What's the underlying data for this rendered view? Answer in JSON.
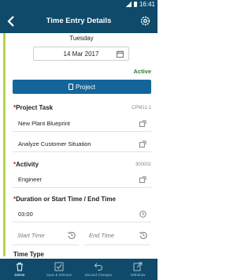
{
  "status_bar": {
    "time": "16:41"
  },
  "header": {
    "title": "Time Entry Details",
    "back_icon": "back-chevron-icon",
    "settings_icon": "gear-icon"
  },
  "entry": {
    "day": "Tuesday",
    "date": "14 Mar 2017",
    "status": "Active"
  },
  "project_button": {
    "label": "Project",
    "icon": "clipboard-icon"
  },
  "project_task": {
    "label": "Project Task",
    "code": "CPM11-1",
    "value": "New Plant Blueprint",
    "secondary_value": "Analyze Customer Situation"
  },
  "activity": {
    "label": "Activity",
    "code": "300002",
    "value": "Engineer"
  },
  "duration": {
    "label": "Duration or Start Time / End Time",
    "value": "03:00",
    "start_placeholder": "Start Time",
    "end_placeholder": "End Time"
  },
  "time_type": {
    "label": "Time Type"
  },
  "bottom_nav": [
    {
      "label": "Delete",
      "icon": "trash-icon"
    },
    {
      "label": "Save & Release",
      "icon": "check-icon"
    },
    {
      "label": "Discard Changes",
      "icon": "undo-icon"
    },
    {
      "label": "Withdraw",
      "icon": "withdraw-icon"
    }
  ],
  "colors": {
    "header": "#0f4a6b",
    "accent": "#14669a",
    "status_active": "#2a7d2e",
    "stripe": "#b6d64a"
  }
}
